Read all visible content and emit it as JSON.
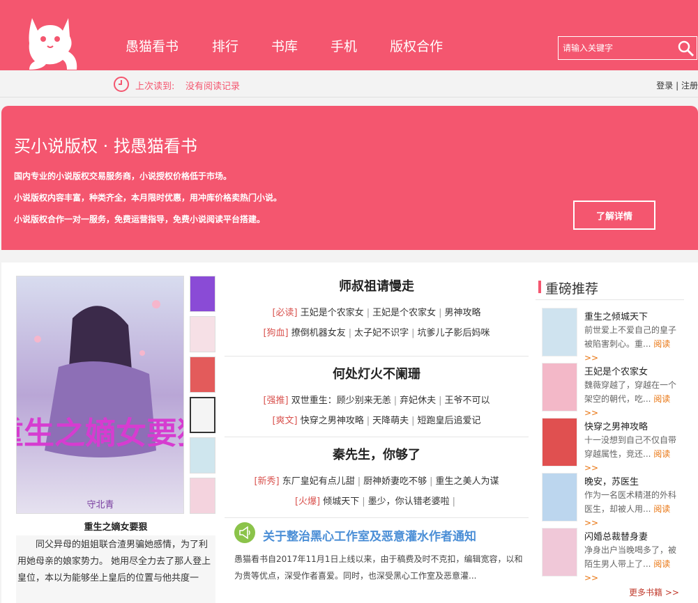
{
  "nav": [
    "愚猫看书",
    "排行",
    "书库",
    "手机",
    "版权合作"
  ],
  "search": {
    "placeholder": "请输入关键字"
  },
  "last_read": {
    "label": "上次读到:",
    "value": "没有阅读记录"
  },
  "auth": {
    "login": "登录",
    "sep": "|",
    "register": "注册"
  },
  "banner": {
    "title": "买小说版权 · 找愚猫看书",
    "lines": [
      "国内专业的小说版权交易服务商，小说授权价格低于市场。",
      "小说版权内容丰富，种类齐全，本月限时优惠，用冲库价格卖热门小说。",
      "小说版权合作一对一服务，免费运营指导，免费小说阅读平台搭建。"
    ],
    "button": "了解详情"
  },
  "featured": {
    "cover_text": "重生之嫡女要狠",
    "cover_author": "守北青",
    "title": "重生之嫡女要狠",
    "desc": "同父异母的姐姐联合渣男骗她感情，为了利用她母亲的娘家势力。 她用尽全力去了那人登上皇位，本以为能够坐上皇后的位置与他共度一"
  },
  "blocks": [
    {
      "title": "师叔祖请慢走",
      "rows": [
        {
          "tag": "[必读]",
          "items": [
            "王妃是个农家女",
            "王妃是个农家女",
            "男神攻略"
          ]
        },
        {
          "tag": "[狗血]",
          "items": [
            "撩倒机器女友",
            "太子妃不识字",
            "坑爹儿子影后妈咪"
          ]
        }
      ]
    },
    {
      "title": "何处灯火不阑珊",
      "rows": [
        {
          "tag": "[强推]",
          "items": [
            "双世重生：顾少别来无恙",
            "弃妃休夫",
            "王爷不可以"
          ]
        },
        {
          "tag": "[爽文]",
          "items": [
            "快穿之男神攻略",
            "天降萌夫",
            "短跑皇后追爱记"
          ]
        }
      ]
    },
    {
      "title": "秦先生，你够了",
      "rows": [
        {
          "tag": "[新秀]",
          "items": [
            "东厂皇妃有点儿甜",
            "厨神娇妻吃不够",
            "重生之美人为谋"
          ]
        },
        {
          "tag": "[火爆]",
          "items": [
            "倾城天下",
            "墨少，你认错老婆啦"
          ]
        }
      ]
    }
  ],
  "notice": {
    "title": "关于整治黑心工作室及恶意灌水作者通知",
    "text": "愚猫看书自2017年11月1日上线以来，由于稿费及时不克扣，编辑宽容，以和为贵等优点，深受作者喜爱。同时，也深受黑心工作室及恶意灌..."
  },
  "recommend": {
    "title": "重磅推荐",
    "read_label": "阅读>>",
    "items": [
      {
        "title": "重生之倾城天下",
        "desc": "前世爱上不爱自己的皇子被陷害刺心。重...",
        "color": "#cfe3ef"
      },
      {
        "title": "王妃是个农家女",
        "desc": "魏薇穿越了，穿越在一个架空的朝代，吃...",
        "color": "#f3b8c8"
      },
      {
        "title": "快穿之男神攻略",
        "desc": "十一没想到自己不仅自带穿越属性，竞还...",
        "color": "#e05050"
      },
      {
        "title": "晚安，苏医生",
        "desc": "作为一名医术精湛的外科医生，却被人用...",
        "color": "#bcd6ee"
      },
      {
        "title": "闪婚总裁替身妻",
        "desc": "净身出户当晚喝多了，被陌生男人带上了...",
        "color": "#f0c8d8"
      }
    ]
  },
  "more_books": "更多书籍 >>"
}
